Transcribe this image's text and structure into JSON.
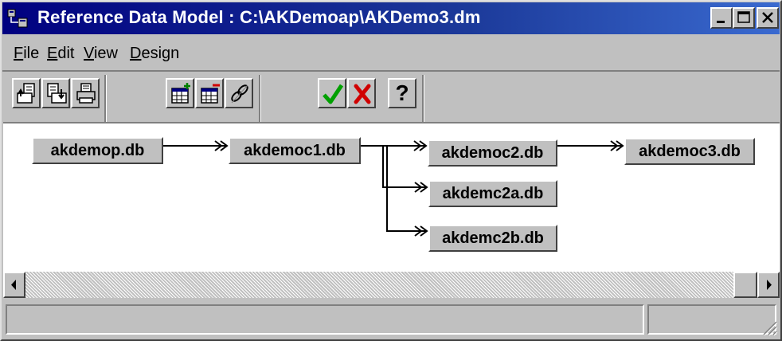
{
  "window": {
    "title": "Reference Data Model : C:\\AKDemoap\\AKDemo3.dm"
  },
  "menu": {
    "items": [
      {
        "mnemonic": "F",
        "rest": "ile"
      },
      {
        "mnemonic": "E",
        "rest": "dit"
      },
      {
        "mnemonic": "V",
        "rest": "iew"
      },
      {
        "mnemonic": "D",
        "rest": "esign"
      }
    ]
  },
  "toolbar": {
    "help_label": "?",
    "icons": [
      "open-model-icon",
      "save-model-icon",
      "print-icon",
      "add-table-icon",
      "remove-table-icon",
      "link-tables-icon",
      "accept-check-icon",
      "cancel-x-icon",
      "help-icon"
    ]
  },
  "diagram": {
    "nodes": [
      {
        "id": "akdemop",
        "label": "akdemop.db"
      },
      {
        "id": "akdemoc1",
        "label": "akdemoc1.db"
      },
      {
        "id": "akdemoc2",
        "label": "akdemoc2.db"
      },
      {
        "id": "akdemoc3",
        "label": "akdemoc3.db"
      },
      {
        "id": "akdemc2a",
        "label": "akdemc2a.db"
      },
      {
        "id": "akdemc2b",
        "label": "akdemc2b.db"
      }
    ],
    "links": [
      {
        "from": "akdemop",
        "to": "akdemoc1"
      },
      {
        "from": "akdemoc1",
        "to": "akdemoc2"
      },
      {
        "from": "akdemoc1",
        "to": "akdemc2a"
      },
      {
        "from": "akdemoc1",
        "to": "akdemc2b"
      },
      {
        "from": "akdemoc2",
        "to": "akdemoc3"
      }
    ]
  },
  "statusbar": {
    "main_text": "",
    "secondary_text": ""
  },
  "colors": {
    "title_bar_start": "#000080",
    "title_bar_end": "#3a6ad0",
    "face": "#c0c0c0",
    "check_green": "#00a000",
    "cancel_red": "#d00000"
  }
}
